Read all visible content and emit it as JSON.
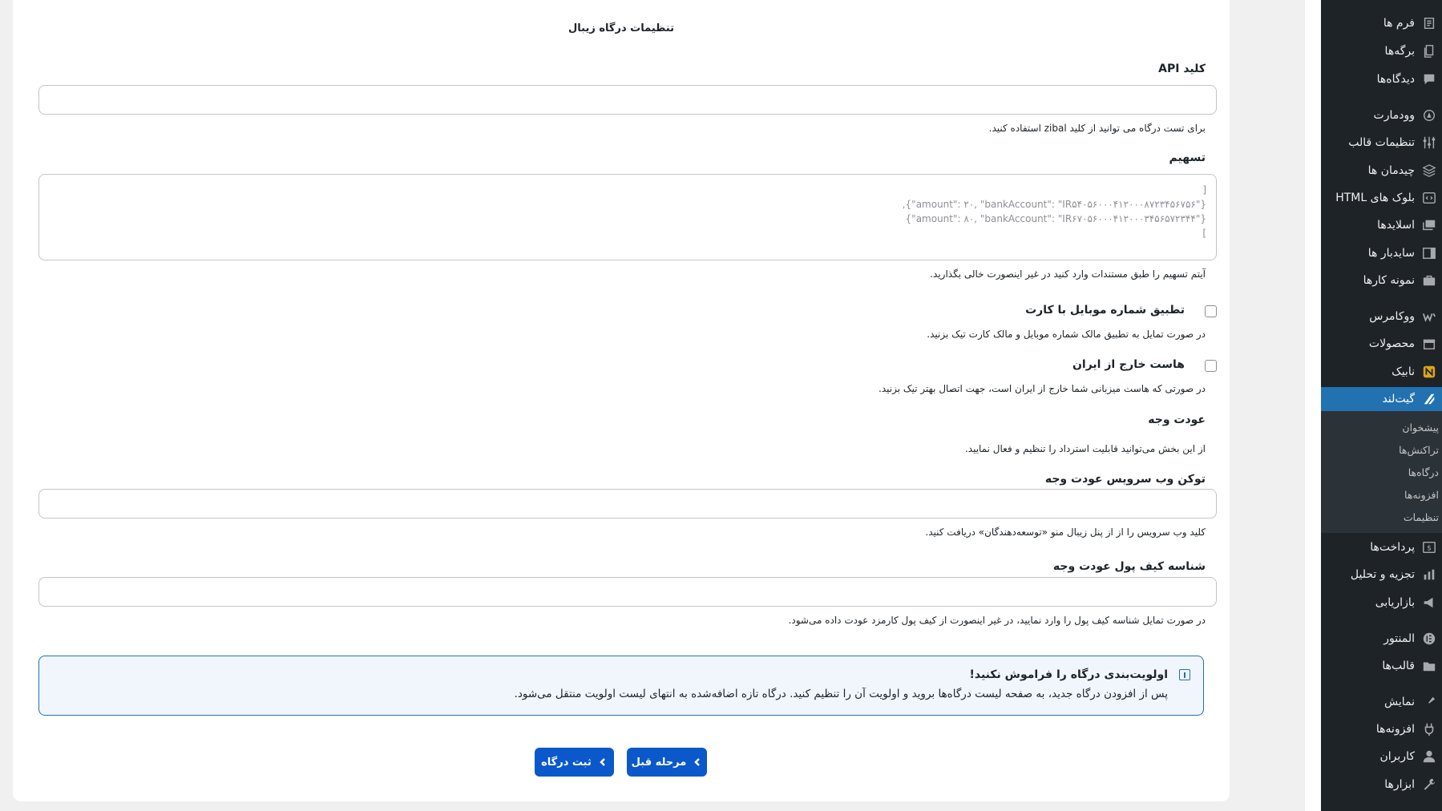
{
  "form": {
    "title": "تنظیمات درگاه زیبال",
    "api_key": {
      "label": "کلید API",
      "value": "",
      "hint": "برای تست درگاه می توانید از کلید zibal استفاده کنید."
    },
    "split": {
      "label": "تسهیم",
      "placeholder": "[\n{\"amount\": ۲۰, \"bankAccount\": \"IR۵۴۰۵۶۰۰۰۴۱۲۰۰۰۸۷۲۳۴۵۶۷۵۶\"},\n{\"amount\": ۸۰, \"bankAccount\": \"IR۶۷۰۵۶۰۰۰۴۱۲۰۰۰۳۴۵۶۵۷۲۳۴۴\"}\n]",
      "hint": "آیتم تسهیم را طبق مستندات وارد کنید در غیر اینصورت خالی بگذارید."
    },
    "mobile_match": {
      "label": "تطبیق شماره موبایل با کارت",
      "hint": "در صورت تمایل به تطبیق مالک شماره موبایل و مالک کارت تیک بزنید."
    },
    "foreign_host": {
      "label": "هاست خارج از ایران",
      "hint": "در صورتی که هاست میزبانی شما خارج از ایران است، جهت اتصال بهتر تیک بزنید."
    },
    "refund": {
      "label": "عودت وجه",
      "hint": "از این بخش می‌توانید قابلیت استرداد را تنظیم و فعال نمایید."
    },
    "refund_token": {
      "label": "توکن وب سرویس عودت وجه",
      "value": "",
      "hint": "کلید وب سرویس را از از پنل زیبال منو «توسعه‌دهندگان» دریافت کنید."
    },
    "wallet_id": {
      "label": "شناسه کیف پول عودت وجه",
      "value": "",
      "hint": "در صورت تمایل شناسه کیف پول را وارد نمایید، در غیر اینصورت از کیف پول کارمزد عودت داده می‌شود."
    },
    "notice": {
      "title": "اولویت‌بندی درگاه را فراموش نکنید!",
      "body": "پس از افزودن درگاه جدید، به صفحه لیست درگاه‌ها بروید و اولویت آن را تنظیم کنید. درگاه تازه اضافه‌شده به انتهای لیست اولویت منتقل می‌شود."
    },
    "buttons": {
      "prev": "مرحله قبل",
      "submit": "ثبت درگاه"
    }
  },
  "sidebar": {
    "items": [
      {
        "label": "فرم ها",
        "icon": "form-icon"
      },
      {
        "label": "برگه‌ها",
        "icon": "pages-icon"
      },
      {
        "label": "دیدگاه‌ها",
        "icon": "comments-icon"
      },
      {
        "label": "وودمارت",
        "icon": "woodmart-icon"
      },
      {
        "label": "تنظیمات قالب",
        "icon": "theme-settings-icon"
      },
      {
        "label": "چیدمان ها",
        "icon": "layouts-icon"
      },
      {
        "label": "بلوک های HTML",
        "icon": "html-blocks-icon"
      },
      {
        "label": "اسلایدها",
        "icon": "slides-icon"
      },
      {
        "label": "سایدبار ها",
        "icon": "sidebars-icon"
      },
      {
        "label": "نمونه کارها",
        "icon": "portfolio-icon"
      },
      {
        "label": "ووکامرس",
        "icon": "woocommerce-icon"
      },
      {
        "label": "محصولات",
        "icon": "products-icon"
      },
      {
        "label": "نابیک",
        "icon": "nabik-icon"
      },
      {
        "label": "گیت‌لند",
        "icon": "gateland-icon"
      },
      {
        "label": "پرداخت‌ها",
        "icon": "payments-icon"
      },
      {
        "label": "تجزیه و تحلیل",
        "icon": "analytics-icon"
      },
      {
        "label": "بازاریابی",
        "icon": "marketing-icon"
      },
      {
        "label": "المنتور",
        "icon": "elementor-icon"
      },
      {
        "label": "قالب‌ها",
        "icon": "templates-icon"
      },
      {
        "label": "نمایش",
        "icon": "appearance-icon"
      },
      {
        "label": "افزونه‌ها",
        "icon": "plugins-icon"
      },
      {
        "label": "کاربران",
        "icon": "users-icon"
      },
      {
        "label": "ابزارها",
        "icon": "tools-icon"
      }
    ],
    "submenu": [
      "پیشخوان",
      "تراکنش‌ها",
      "درگاه‌ها",
      "افزونه‌ها",
      "تنظیمات"
    ],
    "active_color": "#2271b1"
  }
}
